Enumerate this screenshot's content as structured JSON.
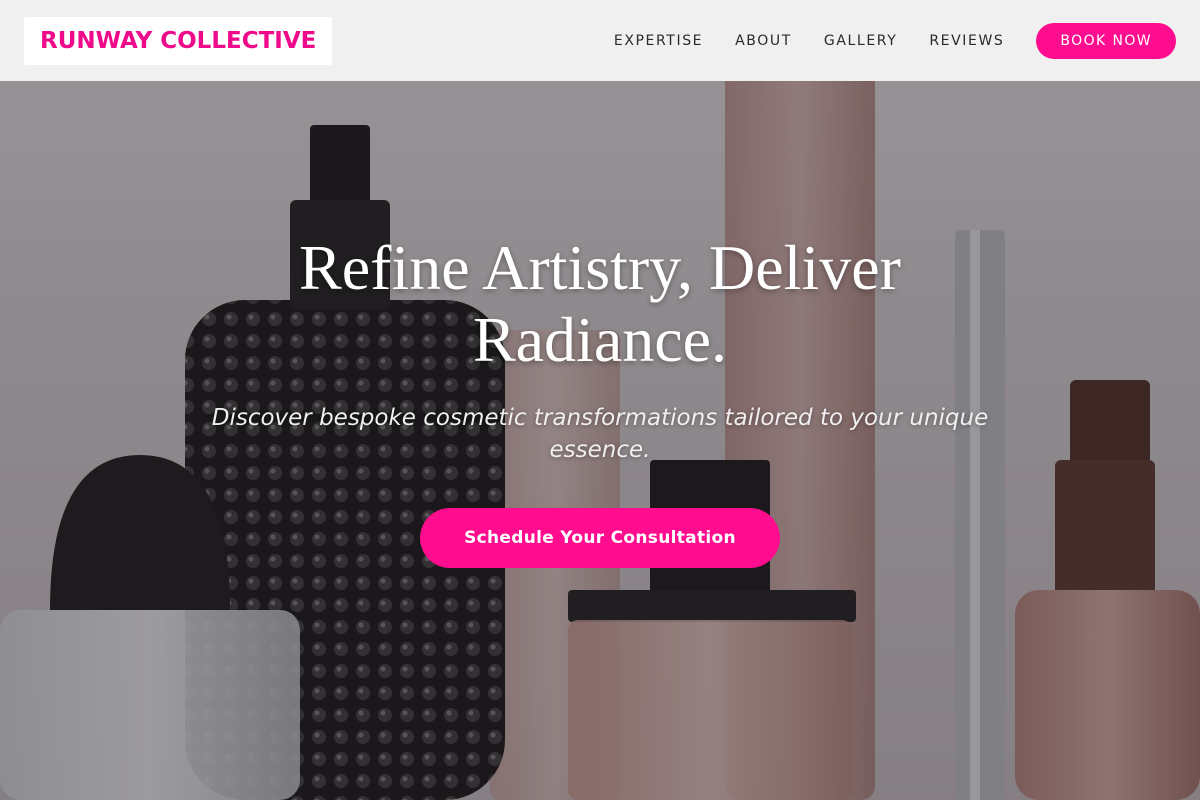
{
  "brand": {
    "name": "RUNWAY COLLECTIVE",
    "accent_color": "#ff0d8e"
  },
  "nav": {
    "items": [
      {
        "label": "EXPERTISE"
      },
      {
        "label": "ABOUT"
      },
      {
        "label": "GALLERY"
      },
      {
        "label": "REVIEWS"
      }
    ],
    "cta_label": "BOOK NOW"
  },
  "hero": {
    "title": "Refine Artistry, Deliver Radiance.",
    "subtitle": "Discover bespoke cosmetic transformations tailored to your unique essence.",
    "cta_label": "Schedule Your Consultation",
    "background": "perfume-bottles-photo"
  }
}
